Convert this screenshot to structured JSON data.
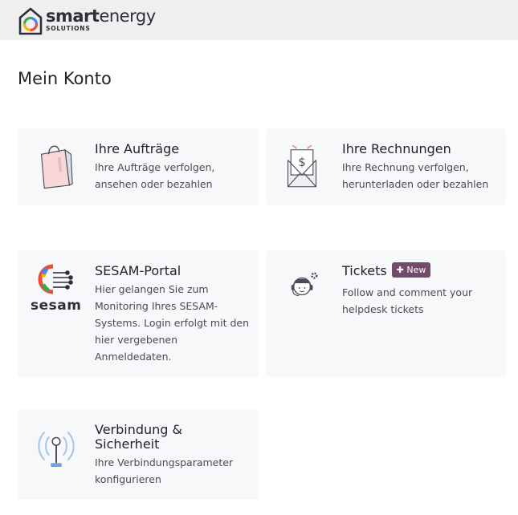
{
  "header": {
    "logo": {
      "name_bold": "smart",
      "name_light": "energy",
      "subtitle": "SOLUTIONS"
    }
  },
  "page": {
    "title": "Mein Konto"
  },
  "cards": [
    {
      "icon": "shopping-bag-icon",
      "title": "Ihre Aufträge",
      "desc_lines": [
        "Ihre Aufträge verfolgen,",
        "ansehen oder bezahlen"
      ]
    },
    {
      "icon": "invoice-envelope-icon",
      "title": "Ihre Rechnungen",
      "desc_lines": [
        "Ihre Rechnung verfolgen,",
        "herunterladen oder bezahlen"
      ]
    },
    {
      "icon": "sesam-logo-icon",
      "icon_text": "sesam",
      "title": "SESAM-Portal",
      "desc_lines": [
        "Hier gelangen Sie zum",
        "Monitoring Ihres SESAM-",
        "Systems. Login erfolgt mit den",
        "hier vergebenen",
        "Anmeldedaten."
      ]
    },
    {
      "icon": "helpdesk-agent-icon",
      "title": "Tickets",
      "badge": "New",
      "desc_lines": [
        "Follow and comment your",
        "helpdesk tickets"
      ]
    },
    {
      "icon": "antenna-icon",
      "title_lines": [
        "Verbindung &",
        "Sicherheit"
      ],
      "desc_lines": [
        "Ihre Verbindungsparameter",
        "konfigurieren"
      ]
    }
  ],
  "colors": {
    "topbar": "#efefef",
    "card_bg": "#f7f8fa",
    "badge": "#714b67"
  }
}
